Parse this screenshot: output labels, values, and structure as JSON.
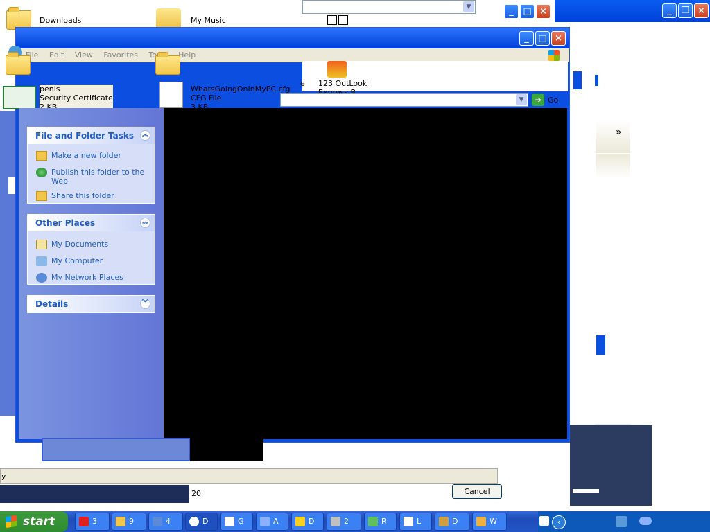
{
  "background": {
    "icons": [
      {
        "name": "Downloads",
        "type": "",
        "size": ""
      },
      {
        "name": "My Music",
        "type": "",
        "size": ""
      },
      {
        "name": "penis",
        "type": "Security Certificate",
        "size": "2 KB"
      },
      {
        "name": "WhatsGoingOnInMyPC.cfg",
        "type": "CFG File",
        "size": "3 KB"
      },
      {
        "name": "123 OutLook",
        "type": "Express B",
        "size": ""
      }
    ],
    "go_label": "Go",
    "double_chevron": "»",
    "stray_e": "e",
    "stray_y": "y",
    "stray_20": "20",
    "cancel_label": "Cancel"
  },
  "window": {
    "menu": [
      "File",
      "Edit",
      "View",
      "Favorites",
      "Tools",
      "Help"
    ]
  },
  "tasks_panel": {
    "file_folder": {
      "title": "File and Folder Tasks",
      "items": [
        "Make a new folder",
        "Publish this folder to the Web",
        "Share this folder"
      ]
    },
    "other_places": {
      "title": "Other Places",
      "items": [
        "My Documents",
        "My Computer",
        "My Network Places"
      ]
    },
    "details": {
      "title": "Details"
    }
  },
  "taskbar": {
    "start_label": "start",
    "buttons": [
      {
        "label": "3",
        "icon": "shield-icon",
        "color": "#e02020"
      },
      {
        "label": "9",
        "icon": "folder-icon",
        "color": "#f2c64a"
      },
      {
        "label": "4",
        "icon": "network-icon",
        "color": "#5a8ad8"
      },
      {
        "label": "D",
        "icon": "disc-icon",
        "color": "#ffffff"
      },
      {
        "label": "G",
        "icon": "grid-icon",
        "color": "#ffffff"
      },
      {
        "label": "A",
        "icon": "app-icon",
        "color": "#8ab0ff"
      },
      {
        "label": "D",
        "icon": "x-icon",
        "color": "#f8d020"
      },
      {
        "label": "2",
        "icon": "tool-icon",
        "color": "#c0c0c0"
      },
      {
        "label": "R",
        "icon": "run-icon",
        "color": "#60c060"
      },
      {
        "label": "L",
        "icon": "window-icon",
        "color": "#ffffff"
      },
      {
        "label": "D",
        "icon": "bug-icon",
        "color": "#d0a040"
      },
      {
        "label": "W",
        "icon": "shield-icon",
        "color": "#f0b040"
      }
    ]
  }
}
